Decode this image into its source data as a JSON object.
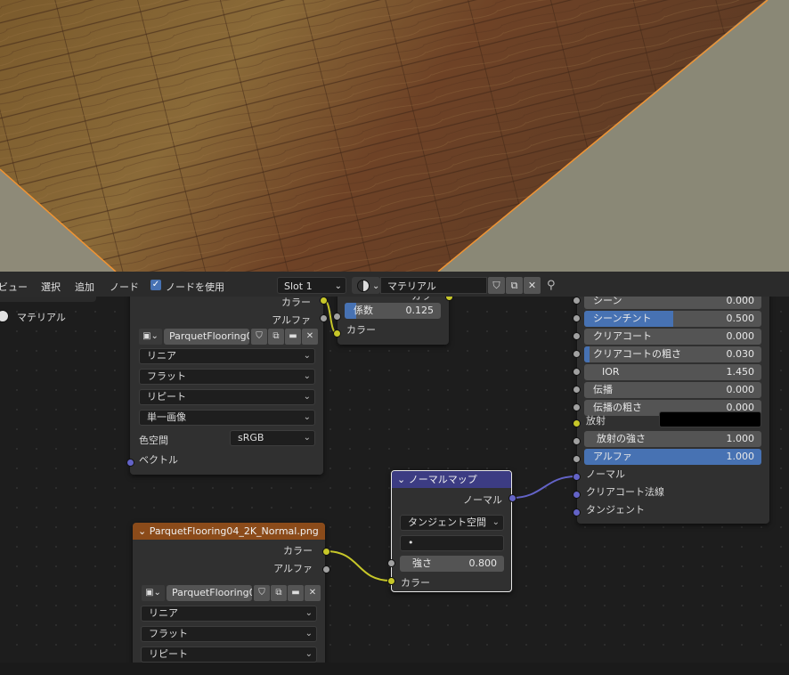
{
  "header": {
    "menu": [
      "ビュー",
      "選択",
      "追加",
      "ノード"
    ],
    "use_nodes_label": "ノードを使用",
    "slot": "Slot 1",
    "material_name": "マテリアル"
  },
  "outliner_label": "マテリアル",
  "image_node_top": {
    "outputs": [
      "カラー",
      "アルファ"
    ],
    "image_name": "ParquetFlooring0...",
    "interpolation": "リニア",
    "projection": "フラット",
    "extension": "リピート",
    "source": "単一画像",
    "color_space_label": "色空間",
    "color_space_value": "sRGB",
    "vector_label": "ベクトル"
  },
  "mix_node": {
    "out_partial": "カラ",
    "factor_label": "係数",
    "factor_value": "0.125",
    "color_label": "カラー"
  },
  "bsdf_node": {
    "rows": [
      {
        "label": "シーン",
        "value": "0.000",
        "fill": 0
      },
      {
        "label": "シーンチント",
        "value": "0.500",
        "fill": 0.5
      },
      {
        "label": "クリアコート",
        "value": "0.000",
        "fill": 0
      },
      {
        "label": "クリアコートの粗さ",
        "value": "0.030",
        "fill": 0.03
      },
      {
        "label": "IOR",
        "value": "1.450",
        "fill": 0
      },
      {
        "label": "伝播",
        "value": "0.000",
        "fill": 0
      },
      {
        "label": "伝播の粗さ",
        "value": "0.000",
        "fill": 0
      }
    ],
    "emission_label": "放射",
    "emission_strength_label": "放射の強さ",
    "emission_strength_value": "1.000",
    "alpha_label": "アルファ",
    "alpha_value": "1.000",
    "inputs": [
      "ノーマル",
      "クリアコート法線",
      "タンジェント"
    ]
  },
  "normal_map_node": {
    "title": "ノーマルマップ",
    "output": "ノーマル",
    "space": "タンジェント空間",
    "uv_value": "•",
    "strength_label": "強さ",
    "strength_value": "0.800",
    "color_label": "カラー"
  },
  "image_node_bottom": {
    "title": "ParquetFlooring04_2K_Normal.png",
    "outputs": [
      "カラー",
      "アルファ"
    ],
    "image_name": "ParquetFlooring0...",
    "interpolation": "リニア",
    "projection": "フラット",
    "extension": "リピート"
  },
  "colors": {
    "texture_header": "#8b4b1a",
    "vector_header": "#3c3c83",
    "accent": "#4772b3",
    "selection": "#f09433"
  }
}
